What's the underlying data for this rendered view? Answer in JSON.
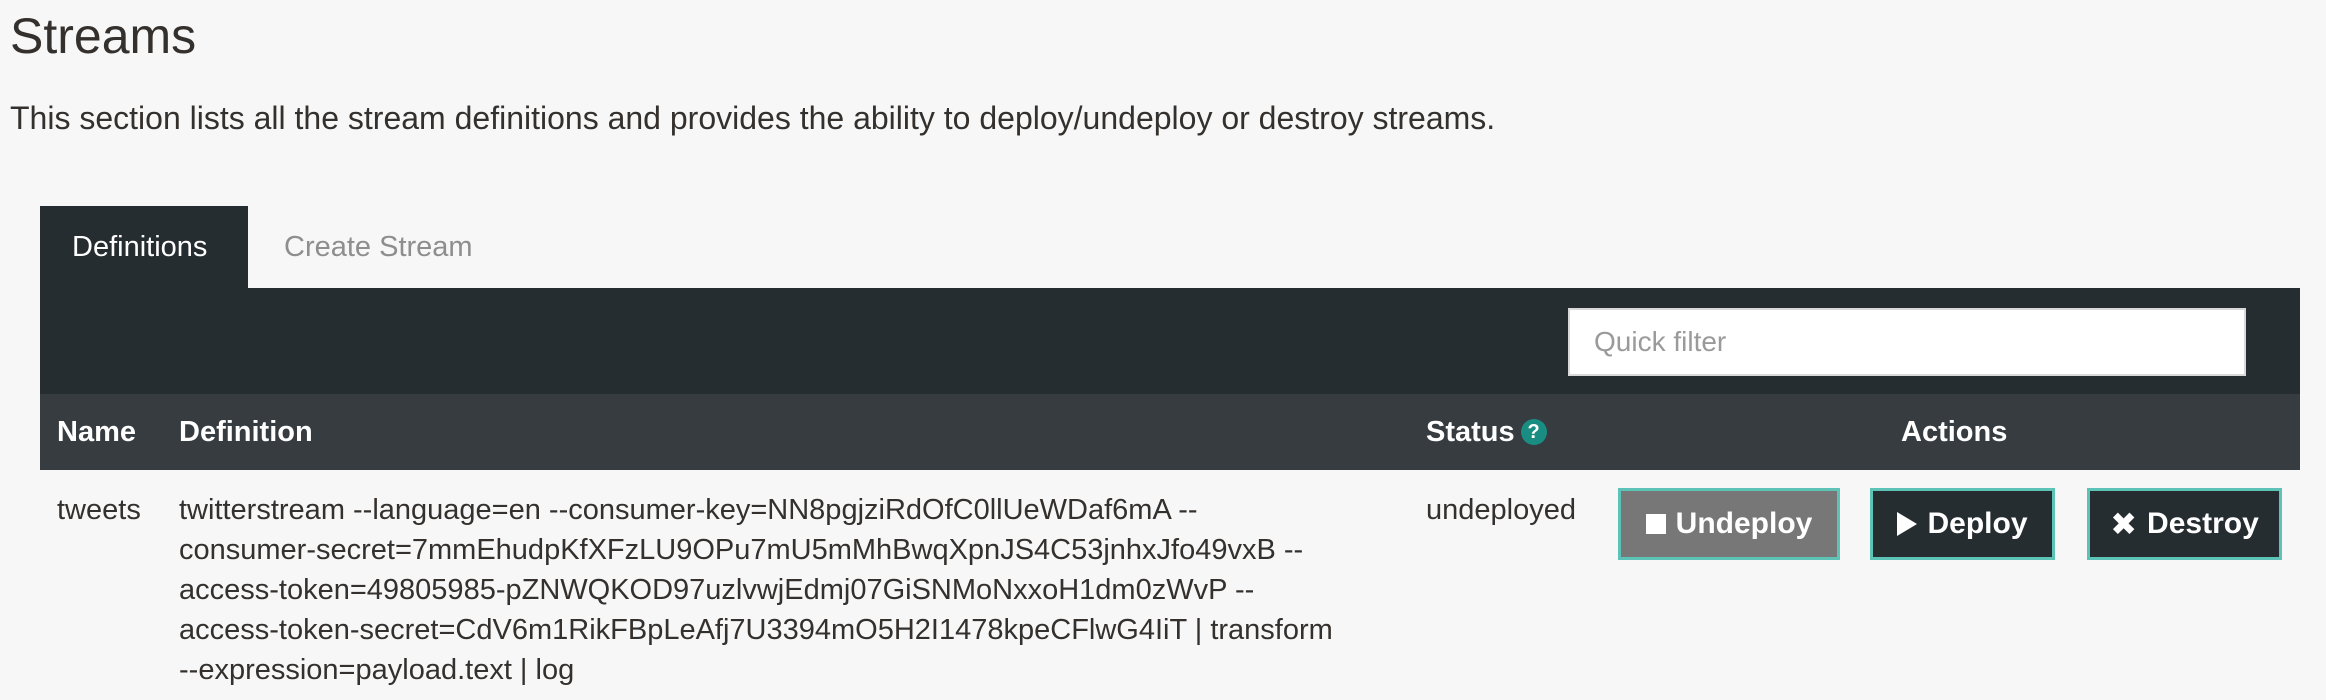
{
  "page": {
    "title": "Streams",
    "description": "This section lists all the stream definitions and provides the ability to deploy/undeploy or destroy streams."
  },
  "tabs": [
    {
      "label": "Definitions",
      "active": true
    },
    {
      "label": "Create Stream",
      "active": false
    }
  ],
  "filter": {
    "placeholder": "Quick filter",
    "value": ""
  },
  "table": {
    "columns": {
      "name": "Name",
      "definition": "Definition",
      "status": "Status",
      "actions": "Actions"
    },
    "status_help_icon": "question-circle-icon",
    "rows": [
      {
        "name": "tweets",
        "definition": "twitterstream --language=en --consumer-key=NN8pgjziRdOfC0llUeWDaf6mA --consumer-secret=7mmEhudpKfXFzLU9OPu7mU5mMhBwqXpnJS4C53jnhxJfo49vxB --access-token=49805985-pZNWQKOD97uzlvwjEdmj07GiSNMoNxxoH1dm0zWvP --access-token-secret=CdV6m1RikFBpLeAfj7U3394mO5H2I1478kpeCFlwG4IiT | transform --expression=payload.text | log",
        "definition_lines": [
          "twitterstream --language=en --consumer-key=NN8pgjziRdOfC0llUeWDaf6mA --",
          "consumer-secret=7mmEhudpKfXFzLU9OPu7mU5mMhBwqXpnJS4C53jnhxJfo49vxB --",
          "access-token=49805985-pZNWQKOD97uzlvwjEdmj07GiSNMoNxxoH1dm0zWvP --",
          "access-token-secret=CdV6m1RikFBpLeAfj7U3394mO5H2I1478kpeCFlwG4IiT | transform",
          "--expression=payload.text | log"
        ],
        "status": "undeployed",
        "actions": {
          "undeploy": {
            "label": "Undeploy",
            "icon": "stop-square-icon"
          },
          "deploy": {
            "label": "Deploy",
            "icon": "play-icon"
          },
          "destroy": {
            "label": "Destroy",
            "icon": "close-x-icon"
          }
        }
      }
    ]
  },
  "colors": {
    "background": "#f7f7f7",
    "header_dark": "#262d31",
    "table_header": "#363c40",
    "accent": "#5dc3b7",
    "help_icon": "#1a8d83",
    "undeploy_button": "#777777"
  }
}
